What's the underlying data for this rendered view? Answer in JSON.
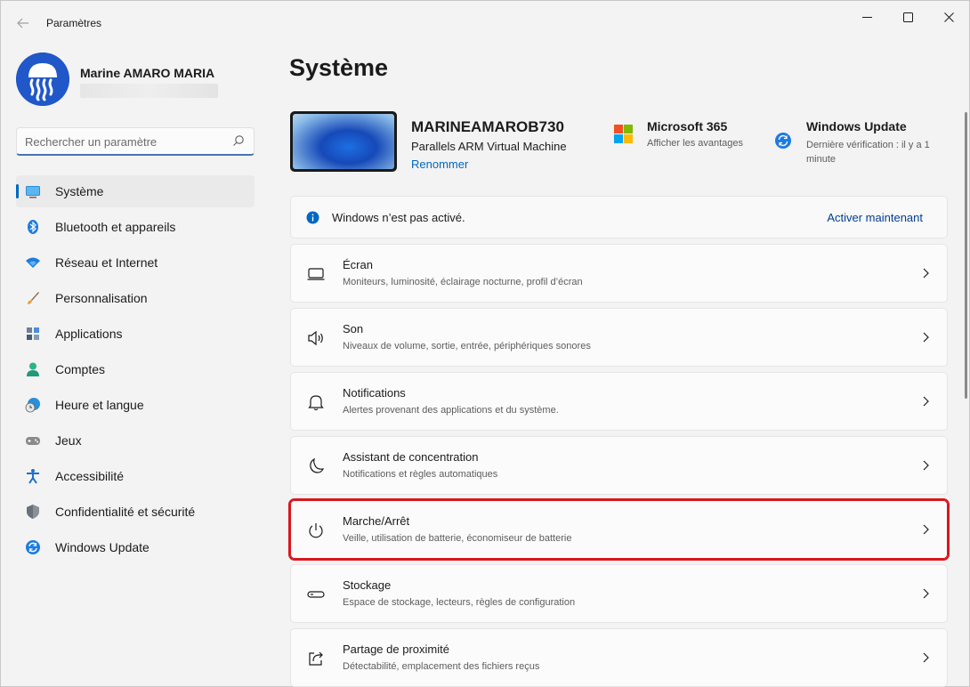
{
  "window": {
    "app_title": "Paramètres",
    "back_icon": "arrow-left-icon",
    "controls": {
      "minimize": "—",
      "maximize": "☐",
      "close": "✕"
    }
  },
  "profile": {
    "name": "Marine AMARO MARIA"
  },
  "search": {
    "placeholder": "Rechercher un paramètre"
  },
  "sidebar": {
    "items": [
      {
        "label": "Système",
        "icon": "monitor-icon",
        "active": true
      },
      {
        "label": "Bluetooth et appareils",
        "icon": "bluetooth-icon"
      },
      {
        "label": "Réseau et Internet",
        "icon": "wifi-icon"
      },
      {
        "label": "Personnalisation",
        "icon": "brush-icon"
      },
      {
        "label": "Applications",
        "icon": "apps-icon"
      },
      {
        "label": "Comptes",
        "icon": "person-icon"
      },
      {
        "label": "Heure et langue",
        "icon": "globe-clock-icon"
      },
      {
        "label": "Jeux",
        "icon": "gamepad-icon"
      },
      {
        "label": "Accessibilité",
        "icon": "accessibility-icon"
      },
      {
        "label": "Confidentialité et sécurité",
        "icon": "shield-icon"
      },
      {
        "label": "Windows Update",
        "icon": "sync-icon"
      }
    ]
  },
  "main": {
    "title": "Système",
    "device": {
      "name": "MARINEAMAROB730",
      "model": "Parallels ARM Virtual Machine",
      "rename_label": "Renommer"
    },
    "ms365": {
      "title": "Microsoft 365",
      "subtitle": "Afficher les avantages"
    },
    "windows_update": {
      "title": "Windows Update",
      "subtitle": "Dernière vérification : il y a 1 minute"
    },
    "banner": {
      "text": "Windows n’est pas activé.",
      "action": "Activer maintenant"
    },
    "cards": [
      {
        "title": "Écran",
        "subtitle": "Moniteurs, luminosité, éclairage nocturne, profil d’écran",
        "icon": "display-icon"
      },
      {
        "title": "Son",
        "subtitle": "Niveaux de volume, sortie, entrée, périphériques sonores",
        "icon": "speaker-icon"
      },
      {
        "title": "Notifications",
        "subtitle": "Alertes provenant des applications et du système.",
        "icon": "bell-icon"
      },
      {
        "title": "Assistant de concentration",
        "subtitle": "Notifications et règles automatiques",
        "icon": "moon-icon"
      },
      {
        "title": "Marche/Arrêt",
        "subtitle": "Veille, utilisation de batterie, économiseur de batterie",
        "icon": "power-icon",
        "highlighted": true
      },
      {
        "title": "Stockage",
        "subtitle": "Espace de stockage, lecteurs, règles de configuration",
        "icon": "drive-icon"
      },
      {
        "title": "Partage de proximité",
        "subtitle": "Détectabilité, emplacement des fichiers reçus",
        "icon": "share-icon"
      }
    ]
  },
  "colors": {
    "accent": "#0067c0",
    "highlight": "#d9161d"
  }
}
